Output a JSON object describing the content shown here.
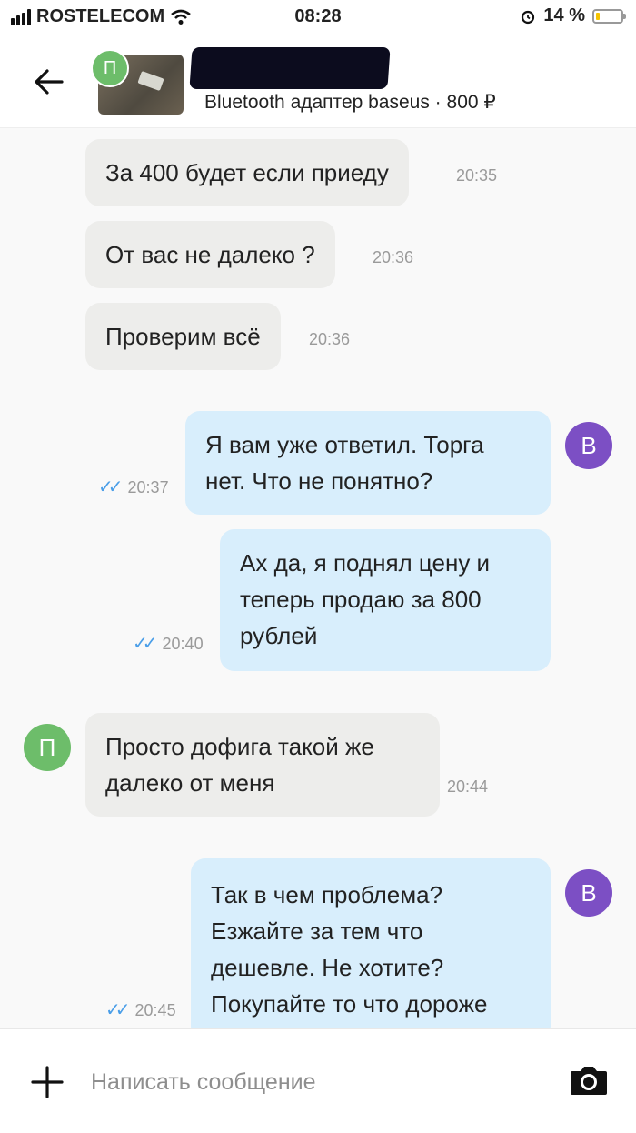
{
  "status_bar": {
    "carrier": "ROSTELECOM",
    "time": "08:28",
    "battery": "14 %",
    "battery_level": 0.14
  },
  "header": {
    "seller_initial": "П",
    "listing": "Bluetooth адаптер baseus · 800 ₽"
  },
  "messages": [
    {
      "side": "in",
      "lines": [
        "За 400 будет если приеду"
      ],
      "time": "20:35"
    },
    {
      "side": "in",
      "lines": [
        "От вас не далеко  ?"
      ],
      "time": "20:36"
    },
    {
      "side": "in",
      "lines": [
        "Проверим всё"
      ],
      "time": "20:36"
    },
    {
      "side": "out",
      "lines": [
        "Я вам уже ответил. Торга",
        "нет. Что не понятно?"
      ],
      "time": "20:37",
      "avatar": "В"
    },
    {
      "side": "out",
      "lines": [
        "Ах да, я поднял цену и",
        "теперь продаю за 800",
        "рублей"
      ],
      "time": "20:40"
    },
    {
      "side": "in",
      "lines": [
        "Просто дофига такой же",
        "далеко от меня"
      ],
      "time": "20:44",
      "avatar": "П"
    },
    {
      "side": "out",
      "lines": [
        "Так в чем проблема?",
        "Езжайте за тем что",
        "дешевле. Не хотите?",
        "Покупайте то что дороже"
      ],
      "time": "20:45",
      "avatar": "В"
    }
  ],
  "input": {
    "placeholder": "Написать сообщение"
  },
  "icons": {
    "back": "back-arrow-icon",
    "add": "plus-icon",
    "camera": "camera-icon"
  },
  "colors": {
    "incoming": "#ededeb",
    "outgoing": "#d8eefc",
    "buyer_avatar": "#7c4fc4",
    "seller_avatar": "#6dbd6a",
    "read_ticks": "#4a9ee8"
  }
}
